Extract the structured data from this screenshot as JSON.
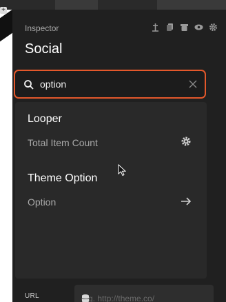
{
  "inspector": {
    "label": "Inspector",
    "title": "Social",
    "toolbar_icons": [
      "pin-icon",
      "copy-icon",
      "trash-icon",
      "eye-icon",
      "gear-icon"
    ]
  },
  "search": {
    "value": "option",
    "placeholder": ""
  },
  "results": {
    "groups": [
      {
        "title": "Looper",
        "item": "Total Item Count",
        "action_icon": "gear-icon"
      },
      {
        "title": "Theme Option",
        "item": "Option",
        "action_icon": "arrow-right-icon"
      }
    ]
  },
  "url_field": {
    "label": "URL",
    "placeholder": "e.g. http://theme.co/"
  },
  "colors": {
    "accent": "#e4582b",
    "panel": "#202020",
    "dropdown": "#292929"
  }
}
